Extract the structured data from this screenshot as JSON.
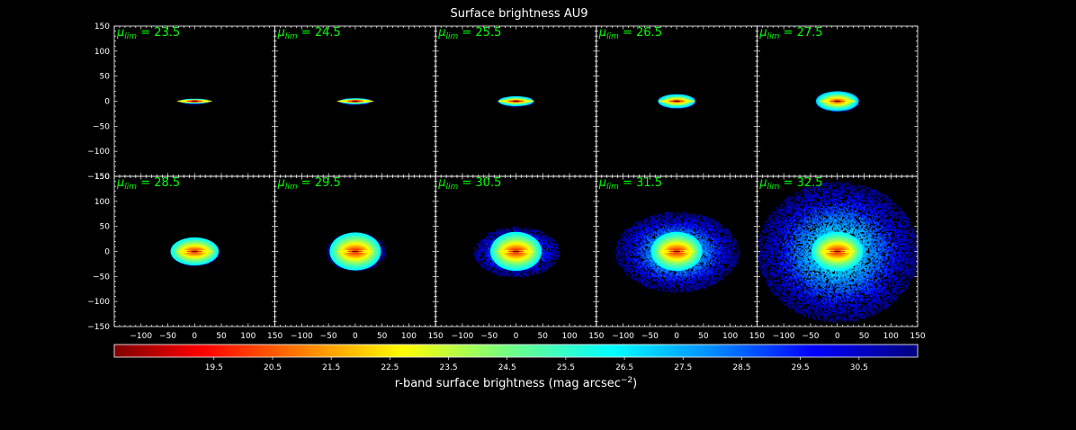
{
  "chart_data": {
    "type": "image-grid",
    "title": "Surface brightness AU9",
    "xlim": [
      -150,
      150
    ],
    "ylim": [
      -150,
      150
    ],
    "x_ticks": [
      -100,
      -50,
      0,
      50,
      100,
      150
    ],
    "y_ticks": [
      -150,
      -100,
      -50,
      0,
      50,
      100,
      150
    ],
    "panel_label_prefix": "μ",
    "panel_label_subscript": "lim",
    "panels": [
      {
        "mu_lim": "23.5",
        "extent_x": 28,
        "extent_y": 5
      },
      {
        "mu_lim": "24.5",
        "extent_x": 30,
        "extent_y": 6
      },
      {
        "mu_lim": "25.5",
        "extent_x": 33,
        "extent_y": 10
      },
      {
        "mu_lim": "26.5",
        "extent_x": 35,
        "extent_y": 14
      },
      {
        "mu_lim": "27.5",
        "extent_x": 40,
        "extent_y": 20
      },
      {
        "mu_lim": "28.5",
        "extent_x": 45,
        "extent_y": 28
      },
      {
        "mu_lim": "29.5",
        "extent_x": 55,
        "extent_y": 38
      },
      {
        "mu_lim": "30.5",
        "extent_x": 80,
        "extent_y": 50
      },
      {
        "mu_lim": "31.5",
        "extent_x": 115,
        "extent_y": 80
      },
      {
        "mu_lim": "32.5",
        "extent_x": 150,
        "extent_y": 140
      }
    ],
    "colorbar": {
      "label": "r-band surface brightness (mag arcsec",
      "label_sup": "−2",
      "label_close": ")",
      "range": [
        17.8,
        31.5
      ],
      "ticks": [
        "19.5",
        "20.5",
        "21.5",
        "22.5",
        "23.5",
        "24.5",
        "25.5",
        "26.5",
        "27.5",
        "28.5",
        "29.5",
        "30.5"
      ],
      "colormap": "jet_r"
    },
    "colors": {
      "background": "#000000",
      "label_green": "#00ff00",
      "frame": "#ffffff"
    }
  }
}
